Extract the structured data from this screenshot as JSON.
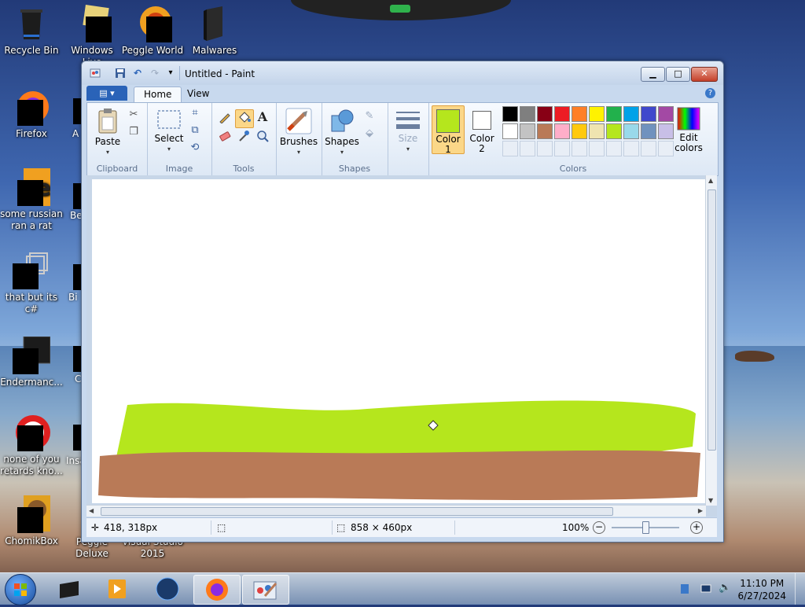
{
  "desktop": {
    "icons": [
      {
        "label": "Recycle Bin"
      },
      {
        "label": "Windows Live"
      },
      {
        "label": "Peggle World"
      },
      {
        "label": "Malwares"
      },
      {
        "label": "Firefox"
      },
      {
        "label": "some russian ran a rat"
      },
      {
        "label": "that but its c#"
      },
      {
        "label": "Endermanc..."
      },
      {
        "label": "none of you retards kno..."
      },
      {
        "label": "ChomikBox"
      },
      {
        "label": "Peggle Deluxe"
      },
      {
        "label": "Visual Studio 2015"
      }
    ]
  },
  "window": {
    "title": "Untitled - Paint",
    "buttons": {
      "minimize": "▁",
      "maximize": "□",
      "close": "✕"
    },
    "quick_access": {
      "save": "💾",
      "undo": "↶",
      "redo": "↷",
      "customize": "▾"
    }
  },
  "ribbon": {
    "file_menu": "▤ ▾",
    "tabs": [
      {
        "label": "Home"
      },
      {
        "label": "View"
      }
    ],
    "help": "?",
    "groups": {
      "clipboard": {
        "label": "Clipboard",
        "paste": "Paste"
      },
      "image": {
        "label": "Image",
        "select": "Select"
      },
      "tools": {
        "label": "Tools"
      },
      "brushes": {
        "label": "Brushes"
      },
      "shapes": {
        "label": "Shapes",
        "button": "Shapes"
      },
      "size": {
        "label": "Size"
      },
      "colors": {
        "label": "Colors",
        "color1": "Color 1",
        "color2": "Color 2",
        "edit": "Edit colors",
        "color1_value": "#b5e61d",
        "color2_value": "#ffffff",
        "palette": [
          "#000000",
          "#7f7f7f",
          "#880015",
          "#ed1c24",
          "#ff7f27",
          "#fff200",
          "#22b14c",
          "#00a2e8",
          "#3f48cc",
          "#a349a4",
          "#ffffff",
          "#c3c3c3",
          "#b97a57",
          "#ffaec9",
          "#ffc90e",
          "#efe4b0",
          "#b5e61d",
          "#99d9ea",
          "#7092be",
          "#c8bfe7"
        ]
      }
    }
  },
  "canvas": {
    "drawing": {
      "grass_color": "#b5e61d",
      "dirt_color": "#b97a57"
    }
  },
  "status": {
    "cursor_pos": "418, 318px",
    "image_size": "858 × 460px",
    "zoom": "100%"
  },
  "taskbar": {
    "clock_time": "11:10 PM",
    "clock_date": "6/27/2024"
  }
}
